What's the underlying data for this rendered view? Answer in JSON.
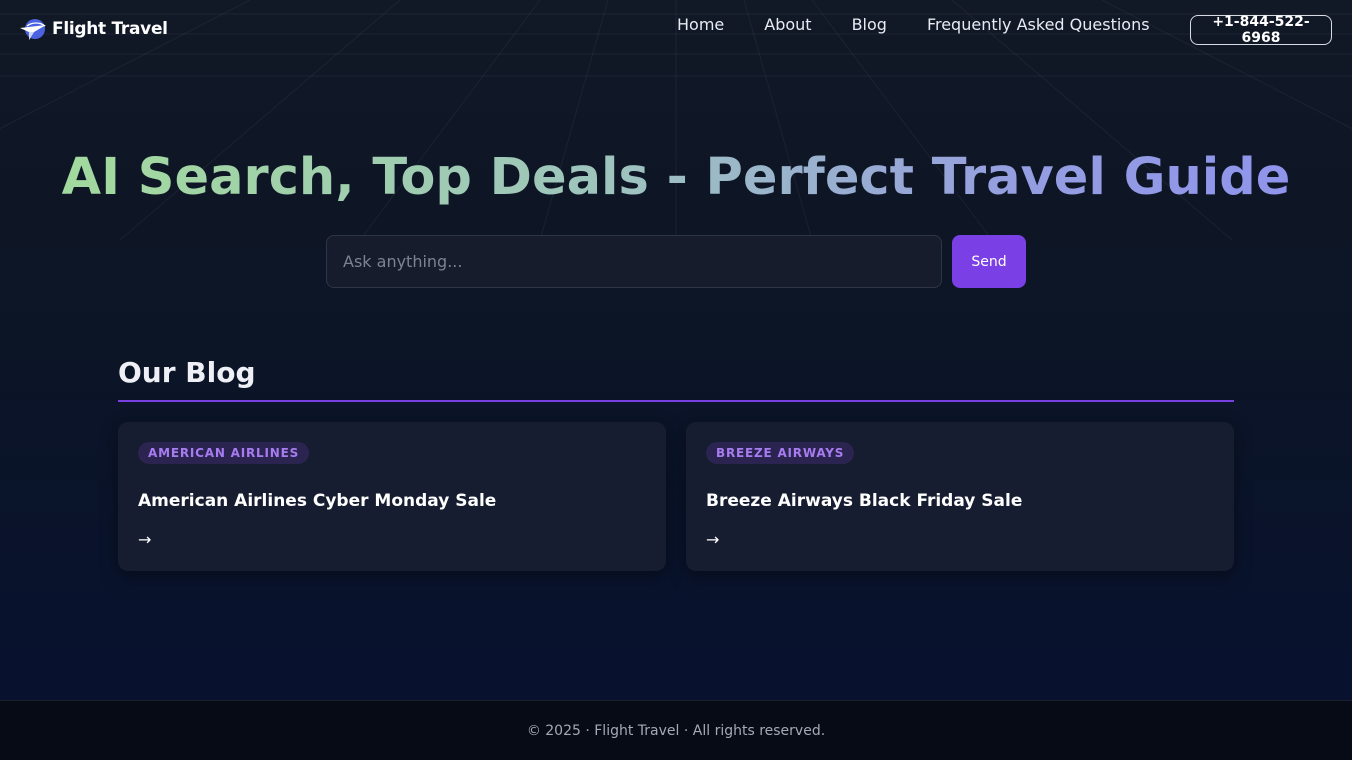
{
  "header": {
    "logo_text": "Flight Travel",
    "nav": [
      {
        "label": "Home"
      },
      {
        "label": "About"
      },
      {
        "label": "Blog"
      },
      {
        "label": "Frequently Asked Questions"
      }
    ],
    "phone": "+1-844-522-6968"
  },
  "hero": {
    "title": "AI Search, Top Deals - Perfect Travel Guide",
    "search_placeholder": "Ask anything...",
    "search_value": "",
    "send_label": "Send"
  },
  "blog": {
    "heading": "Our Blog",
    "posts": [
      {
        "tag": "AMERICAN AIRLINES",
        "title": "American Airlines Cyber Monday Sale",
        "arrow": "→"
      },
      {
        "tag": "BREEZE AIRWAYS",
        "title": "Breeze Airways Black Friday Sale",
        "arrow": "→"
      }
    ]
  },
  "footer": {
    "text": "© 2025 · Flight Travel · All rights reserved."
  },
  "colors": {
    "accent": "#7b3fe6",
    "badge_text": "#a77cf0",
    "card_bg": "#161d30",
    "title_gradient_start": "#a3dc9a",
    "title_gradient_end": "#8e92ee"
  },
  "icons": {
    "logo": "plane-globe-icon",
    "card_link": "arrow-right-icon"
  }
}
